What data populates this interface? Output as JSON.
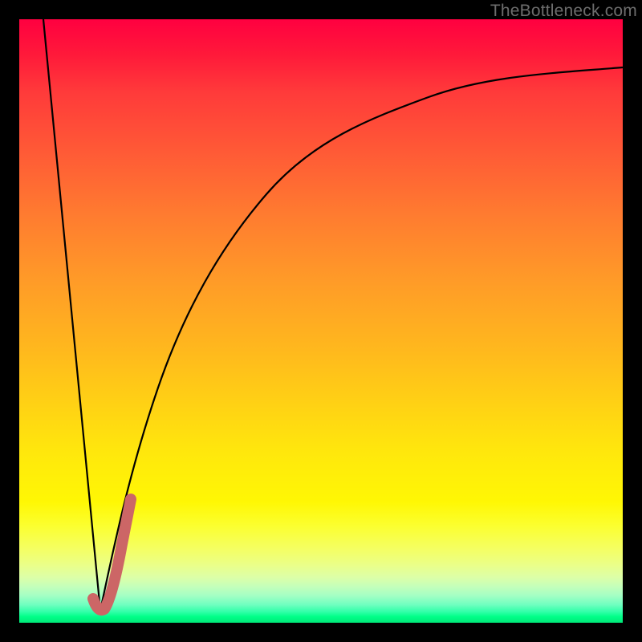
{
  "watermark": "TheBottleneck.com",
  "chart_data": {
    "type": "line",
    "title": "",
    "xlabel": "",
    "ylabel": "",
    "xlim": [
      0,
      100
    ],
    "ylim": [
      0,
      100
    ],
    "grid": false,
    "series": [
      {
        "name": "bottleneck-left",
        "x": [
          4,
          13.5
        ],
        "values": [
          100,
          2
        ],
        "stroke": "#000000",
        "width": 2.2
      },
      {
        "name": "bottleneck-right",
        "x": [
          13.5,
          16,
          19,
          23,
          28,
          34,
          41,
          49,
          58,
          68,
          80,
          92,
          100
        ],
        "values": [
          2,
          14,
          26,
          39,
          51,
          62,
          71,
          78,
          83.5,
          87,
          89.5,
          91,
          92
        ],
        "stroke": "#000000",
        "width": 2.2
      },
      {
        "name": "highlight-segment",
        "x": [
          12.2,
          14.0,
          15.4,
          17.0,
          18.4
        ],
        "values": [
          4.0,
          2.2,
          6.0,
          13.0,
          20.5
        ],
        "stroke": "#cc6666",
        "width": 14
      }
    ],
    "background_gradient": {
      "top": "#ff0040",
      "mid": "#ffd400",
      "bottom": "#00e878"
    }
  }
}
